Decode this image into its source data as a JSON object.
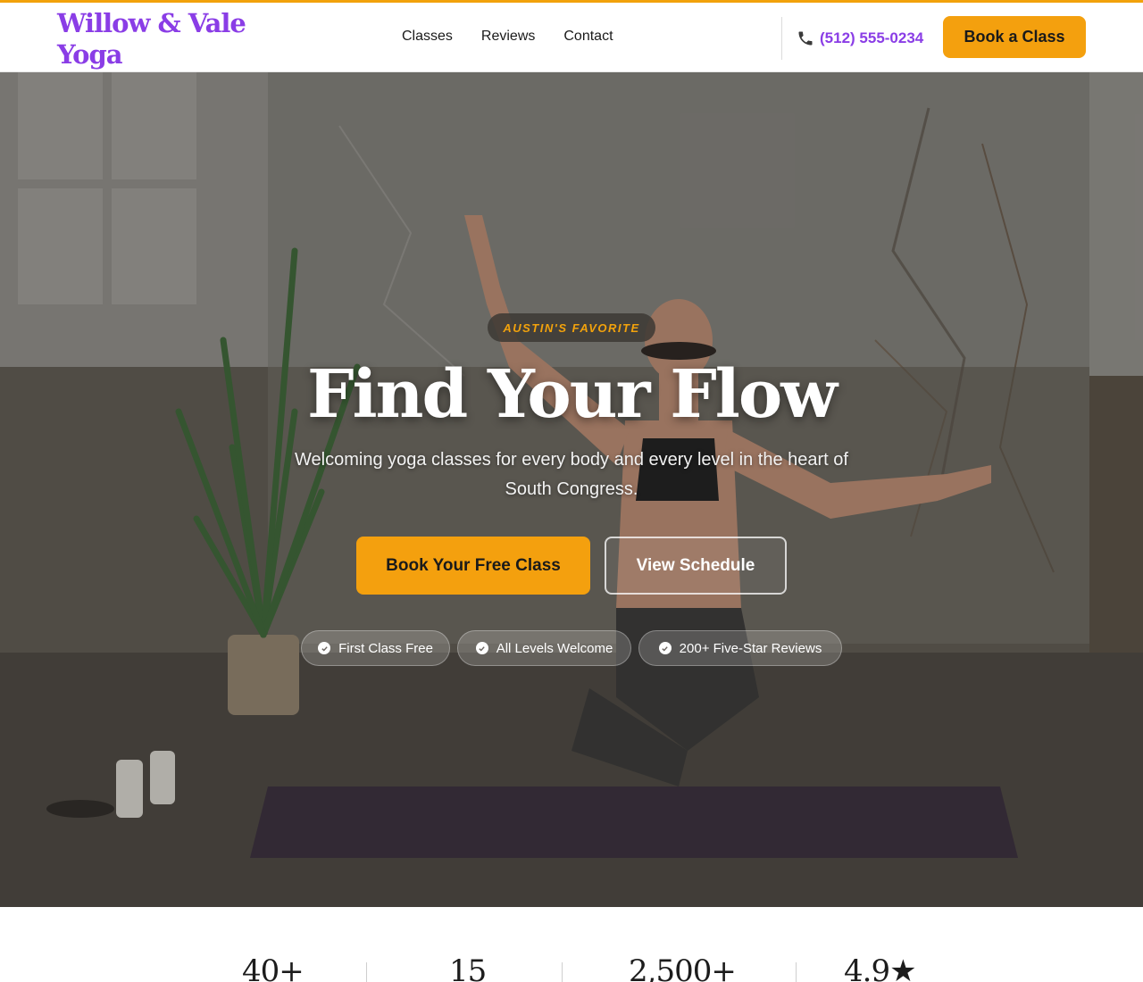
{
  "brand": {
    "name": "Willow & Vale Yoga",
    "accent": "#8a3de6",
    "cta_color": "#f4a00e"
  },
  "nav": {
    "items": [
      {
        "label": "Classes"
      },
      {
        "label": "Reviews"
      },
      {
        "label": "Contact"
      }
    ]
  },
  "header": {
    "phone": "(512) 555-0234",
    "phone_icon": "phone-icon",
    "book_label": "Book a Class"
  },
  "hero": {
    "badge": "AUSTIN'S FAVORITE",
    "title": "Find Your Flow",
    "subtitle": "Welcoming yoga classes for every body and every level in the heart of South Congress.",
    "primary_cta": "Book Your Free Class",
    "secondary_cta": "View Schedule",
    "chips": [
      {
        "label": "First Class Free",
        "icon": "check-circle-icon"
      },
      {
        "label": "All Levels Welcome",
        "icon": "check-circle-icon"
      },
      {
        "label": "200+ Five-Star Reviews",
        "icon": "check-circle-icon"
      }
    ]
  },
  "stats": [
    {
      "value": "40+"
    },
    {
      "value": "15"
    },
    {
      "value": "2,500+"
    },
    {
      "value": "4.9★"
    }
  ]
}
